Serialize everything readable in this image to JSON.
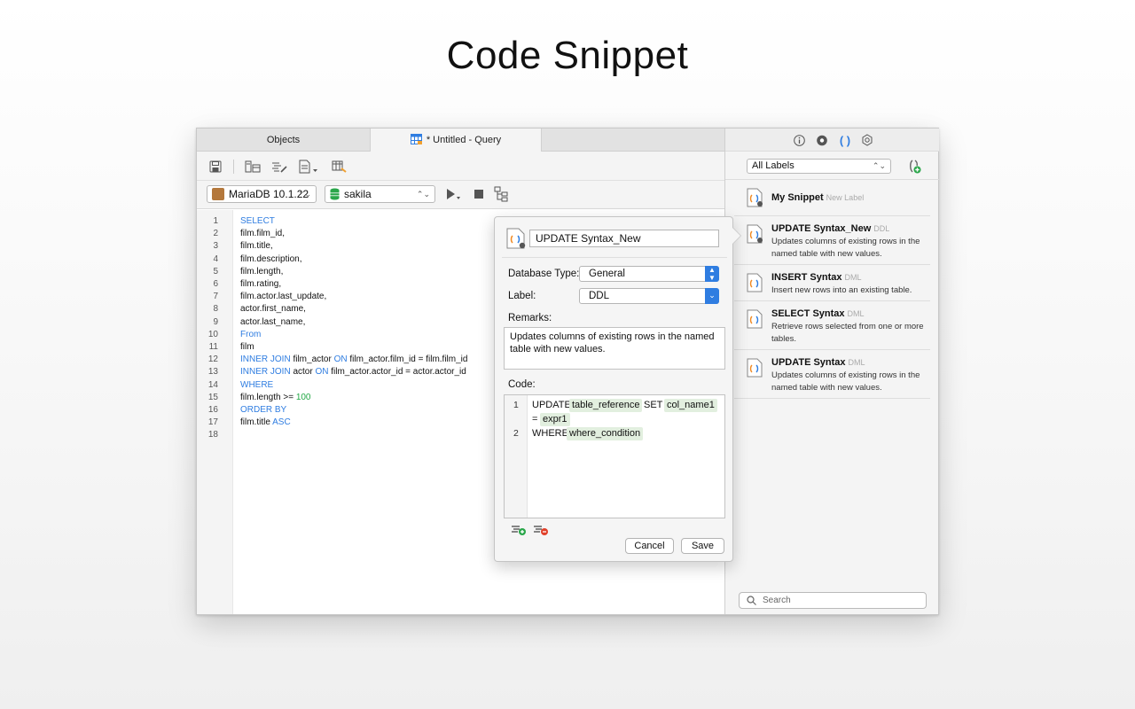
{
  "hero_title": "Code Snippet",
  "tabs": [
    {
      "label": "Objects"
    },
    {
      "label": "* Untitled - Query"
    }
  ],
  "toolbar": {
    "icons": [
      "save-icon",
      "query-builder-icon",
      "beautify-sql-icon",
      "code-snippet-icon",
      "export-result-icon"
    ]
  },
  "connection_bar": {
    "connection": "MariaDB 10.1.22",
    "database": "sakila"
  },
  "editor": {
    "line_numbers": [
      "1",
      "2",
      "3",
      "4",
      "5",
      "6",
      "7",
      "8",
      "9",
      "10",
      "11",
      "12",
      "13",
      "14",
      "15",
      "16",
      "17",
      "18"
    ],
    "lines": [
      [
        {
          "t": "SELECT",
          "k": "kw"
        }
      ],
      [
        {
          "t": "film.film_id,"
        }
      ],
      [
        {
          "t": "film.title,"
        }
      ],
      [
        {
          "t": "film.description,"
        }
      ],
      [
        {
          "t": "film.length,"
        }
      ],
      [
        {
          "t": "film.rating,"
        }
      ],
      [
        {
          "t": "film.actor.last_update,"
        }
      ],
      [
        {
          "t": "actor.first_name,"
        }
      ],
      [
        {
          "t": "actor.last_name,"
        }
      ],
      [
        {
          "t": "From",
          "k": "kw"
        }
      ],
      [
        {
          "t": "film"
        }
      ],
      [
        {
          "t": "INNER JOIN",
          "k": "kw"
        },
        {
          "t": " film_actor "
        },
        {
          "t": "ON",
          "k": "kw"
        },
        {
          "t": " film_actor.film_id = film.film_id"
        }
      ],
      [
        {
          "t": "INNER JOIN",
          "k": "kw"
        },
        {
          "t": " actor "
        },
        {
          "t": "ON",
          "k": "kw"
        },
        {
          "t": " film_actor.actor_id = actor.actor_id"
        }
      ],
      [
        {
          "t": "WHERE",
          "k": "kw"
        }
      ],
      [
        {
          "t": "film.length >= "
        },
        {
          "t": "100",
          "k": "num"
        }
      ],
      [
        {
          "t": "ORDER BY",
          "k": "kw"
        }
      ],
      [
        {
          "t": "film.title "
        },
        {
          "t": "ASC",
          "k": "kw"
        }
      ],
      []
    ]
  },
  "snippet_pane": {
    "labels_filter": "All Labels",
    "items": [
      {
        "title": "My Snippet",
        "label": "New Label",
        "description": ""
      },
      {
        "title": "UPDATE Syntax_New",
        "label": "DDL",
        "description": "Updates columns of existing rows in the named table with new values."
      },
      {
        "title": "INSERT Syntax",
        "label": "DML",
        "description": "Insert new rows into an existing table."
      },
      {
        "title": "SELECT Syntax",
        "label": "DML",
        "description": "Retrieve rows selected from one or more tables."
      },
      {
        "title": "UPDATE Syntax",
        "label": "DML",
        "description": "Updates columns of existing rows in the named table with new values."
      }
    ],
    "search_placeholder": "Search"
  },
  "popover": {
    "name": "UPDATE Syntax_New",
    "database_type_label": "Database Type:",
    "database_type": "General",
    "label_label": "Label:",
    "label_value": "DDL",
    "remarks_label": "Remarks:",
    "remarks": "Updates columns of existing rows in the named table with new values.",
    "code_label": "Code:",
    "code": {
      "line1_no": "1",
      "line2_no": "2",
      "update_kw": "UPDATE",
      "table_ref": "table_reference",
      "set_kw": "SET",
      "col_name": "col_name1",
      "eq": "=",
      "expr": "expr1",
      "where_kw": "WHERE",
      "where_cond": "where_condition"
    },
    "cancel": "Cancel",
    "save": "Save"
  },
  "colors": {
    "keyword": "#2f7de1",
    "number": "#22a845",
    "accent": "#2f7de1",
    "placeholder_bg": "#e2efdf"
  }
}
